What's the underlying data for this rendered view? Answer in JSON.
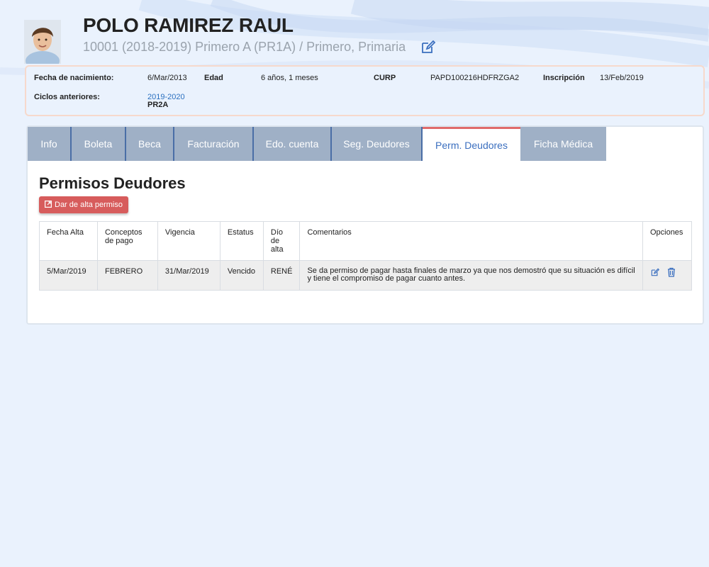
{
  "header": {
    "name": "POLO RAMIREZ RAUL",
    "subtitle": "10001 (2018-2019) Primero A (PR1A) / Primero, Primaria",
    "edit_icon": "edit-icon"
  },
  "info": {
    "birth_label": "Fecha de nacimiento:",
    "birth_value": "6/Mar/2013",
    "age_label": "Edad",
    "age_value": "6 años, 1 meses",
    "curp_label": "CURP",
    "curp_value": "PAPD100216HDFRZGA2",
    "enroll_label": "Inscripción",
    "enroll_value": "13/Feb/2019",
    "previous_label": "Ciclos anteriores:",
    "previous_cycle": "2019-2020",
    "previous_group": "PR2A"
  },
  "tabs": [
    {
      "label": "Info"
    },
    {
      "label": "Boleta"
    },
    {
      "label": "Beca"
    },
    {
      "label": "Facturación"
    },
    {
      "label": "Edo. cuenta"
    },
    {
      "label": "Seg. Deudores"
    },
    {
      "label": "Perm. Deudores"
    },
    {
      "label": "Ficha Médica"
    }
  ],
  "active_tab": "Perm. Deudores",
  "section": {
    "title": "Permisos Deudores",
    "add_button": "Dar de alta permiso"
  },
  "table": {
    "headers": {
      "fecha": "Fecha Alta",
      "conceptos": "Conceptos de pago",
      "vigencia": "Vigencia",
      "estatus": "Estatus",
      "dio": "Dío de alta",
      "comentarios": "Comentarios",
      "opciones": "Opciones"
    },
    "rows": [
      {
        "fecha": "5/Mar/2019",
        "conceptos": "FEBRERO",
        "vigencia": "31/Mar/2019",
        "estatus": "Vencido",
        "dio": "RENÉ",
        "comentarios": "Se da permiso de pagar hasta finales de marzo ya que nos demostró que su situación es difícil y tiene el compromiso de pagar cuanto antes."
      }
    ]
  },
  "colors": {
    "background": "#eaf2fd",
    "tab_inactive": "#9fb0c6",
    "tab_active_accent": "#e06a6a",
    "link": "#2a6fbf",
    "button": "#d75c5c"
  }
}
